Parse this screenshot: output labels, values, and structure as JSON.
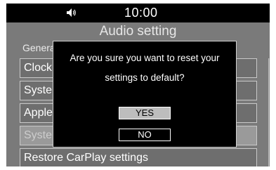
{
  "status_bar": {
    "time": "10:00",
    "volume_icon": "speaker-volume-icon"
  },
  "screen_title": "Audio setting",
  "section_label": "General",
  "menu_items": [
    {
      "label": "Clock"
    },
    {
      "label": "System"
    },
    {
      "label": "Apple"
    },
    {
      "label": "System"
    },
    {
      "label": "Restore CarPlay settings"
    }
  ],
  "dialog": {
    "line1": "Are you sure you want to reset your",
    "line2": "settings to default?",
    "yes_label": "YES",
    "no_label": "NO"
  }
}
